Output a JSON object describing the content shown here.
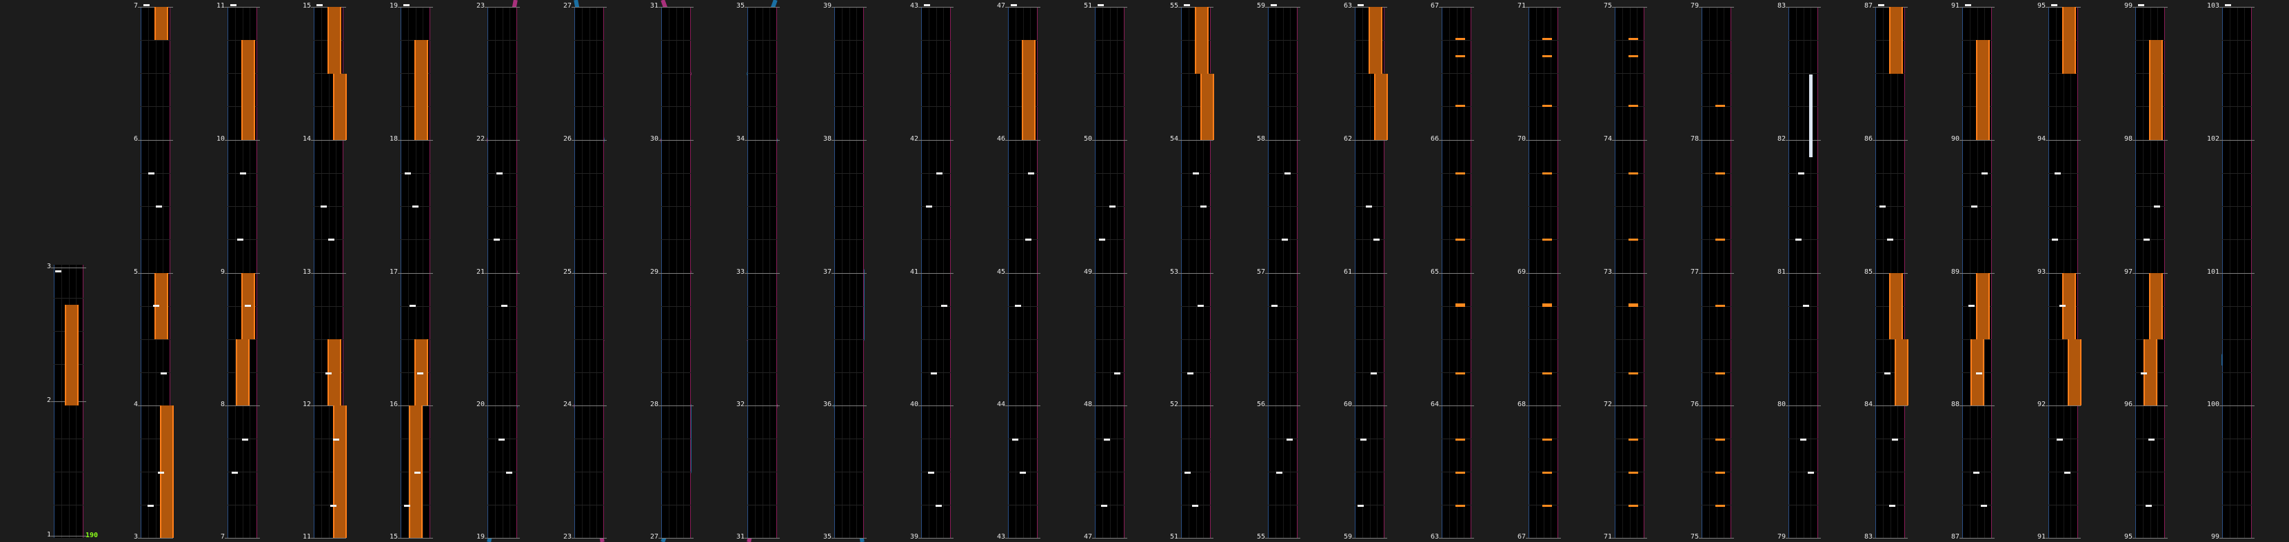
{
  "title": "",
  "bpm_label": "190",
  "colors": {
    "background": "#1c1c1c",
    "lane": "#000000",
    "lane_left_border": "#2a4f86",
    "lane_right_border": "#8a1c57",
    "measure_line": "#7f7f7f",
    "tap_note": "#f2f2f2",
    "ex_note": "#ff8a1e",
    "hold_note": "#b1570c",
    "slide_blue": "#1a6fa3",
    "slide_pink": "#a8307c",
    "bpm_text": "#8cff1a"
  },
  "chart": {
    "total_measures": 103,
    "measures_per_column": 4,
    "first_column_start": 1,
    "columns": [
      {
        "labels": [
          "3",
          "2",
          "1"
        ]
      },
      {
        "labels": [
          "7",
          "6",
          "5",
          "4",
          "3"
        ]
      },
      {
        "labels": [
          "11",
          "10",
          "9",
          "8",
          "7"
        ]
      },
      {
        "labels": [
          "15",
          "14",
          "13",
          "12",
          "11"
        ]
      },
      {
        "labels": [
          "19",
          "18",
          "17",
          "16",
          "15"
        ]
      },
      {
        "labels": [
          "23",
          "22",
          "21",
          "20",
          "19"
        ]
      },
      {
        "labels": [
          "27",
          "26",
          "25",
          "24",
          "23"
        ]
      },
      {
        "labels": [
          "31",
          "30",
          "29",
          "28",
          "27"
        ]
      },
      {
        "labels": [
          "35",
          "34",
          "33",
          "32",
          "31"
        ]
      },
      {
        "labels": [
          "39",
          "38",
          "37",
          "36",
          "35"
        ]
      },
      {
        "labels": [
          "43",
          "42",
          "41",
          "40",
          "39"
        ]
      },
      {
        "labels": [
          "47",
          "46",
          "45",
          "44",
          "43"
        ]
      },
      {
        "labels": [
          "51",
          "50",
          "49",
          "48",
          "47"
        ]
      },
      {
        "labels": [
          "55",
          "54",
          "53",
          "52",
          "51"
        ]
      },
      {
        "labels": [
          "59",
          "58",
          "57",
          "56",
          "55"
        ]
      },
      {
        "labels": [
          "63",
          "62",
          "61",
          "60",
          "59"
        ]
      },
      {
        "labels": [
          "67",
          "66",
          "65",
          "64",
          "63"
        ]
      },
      {
        "labels": [
          "71",
          "70",
          "69",
          "68",
          "67"
        ]
      },
      {
        "labels": [
          "75",
          "74",
          "73",
          "72",
          "71"
        ]
      },
      {
        "labels": [
          "79",
          "78",
          "77",
          "76",
          "75"
        ]
      },
      {
        "labels": [
          "83",
          "82",
          "81",
          "80",
          "79"
        ]
      },
      {
        "labels": [
          "87",
          "86",
          "85",
          "84",
          "83"
        ]
      },
      {
        "labels": [
          "91",
          "90",
          "89",
          "88",
          "87"
        ]
      },
      {
        "labels": [
          "95",
          "94",
          "93",
          "92",
          "91"
        ]
      },
      {
        "labels": [
          "99",
          "98",
          "97",
          "96",
          "95"
        ]
      },
      {
        "labels": [
          "103",
          "102",
          "101",
          "100",
          "99"
        ]
      }
    ]
  }
}
